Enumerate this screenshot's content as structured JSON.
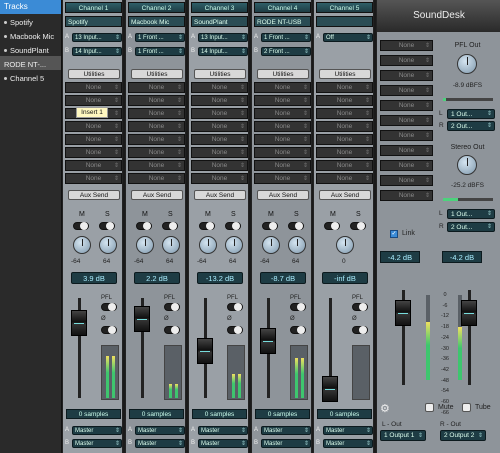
{
  "sidebar": {
    "header": "Tracks",
    "items": [
      {
        "label": "Spotify"
      },
      {
        "label": "Macbook Mic"
      },
      {
        "label": "SoundPlant"
      },
      {
        "label": "RODE NT-..."
      },
      {
        "label": "Channel 5"
      }
    ]
  },
  "channels": [
    {
      "name": "Channel 1",
      "device": "Spotify",
      "in_a": "13 Input...",
      "in_b": "14 Input...",
      "inserts": [
        "None",
        "None",
        "None",
        "None",
        "None",
        "None",
        "None",
        "None"
      ],
      "gain": "3.9 dB",
      "pan_l": "-64",
      "pan_r": "64",
      "samples": "0 samples",
      "out_a": "Master",
      "out_b": "Master"
    },
    {
      "name": "Channel 2",
      "device": "Macbook Mic",
      "in_a": "1 Front ...",
      "in_b": "1 Front ...",
      "inserts": [
        "None",
        "None",
        "None",
        "None",
        "None",
        "None",
        "None",
        "None"
      ],
      "gain": "2.2 dB",
      "pan_l": "-64",
      "pan_r": "64",
      "samples": "0 samples",
      "out_a": "Master",
      "out_b": "Master"
    },
    {
      "name": "Channel 3",
      "device": "SoundPlant",
      "in_a": "13 Input...",
      "in_b": "14 Input...",
      "inserts": [
        "None",
        "None",
        "None",
        "None",
        "None",
        "None",
        "None",
        "None"
      ],
      "gain": "-13.2 dB",
      "pan_l": "-64",
      "pan_r": "64",
      "samples": "0 samples",
      "out_a": "Master",
      "out_b": "Master"
    },
    {
      "name": "Channel 4",
      "device": "RODE NT-USB",
      "in_a": "1 Front ...",
      "in_b": "2 Front ...",
      "inserts": [
        "None",
        "None",
        "None",
        "None",
        "None",
        "None",
        "None",
        "None"
      ],
      "gain": "-8.7 dB",
      "pan_l": "-64",
      "pan_r": "64",
      "samples": "0 samples",
      "out_a": "Master",
      "out_b": "Master"
    },
    {
      "name": "Channel 5",
      "device": "",
      "in_a": "Off",
      "in_b": "",
      "inserts": [
        "None",
        "None",
        "None",
        "None",
        "None",
        "None",
        "None",
        "None"
      ],
      "gain": "-inf dB",
      "pan_l": "",
      "pan_r": "",
      "pan_c": "0",
      "samples": "0 samples",
      "out_a": "Master",
      "out_b": "Master"
    }
  ],
  "labels": {
    "utilities": "Utilities",
    "aux_send": "Aux Send",
    "mute": "M",
    "solo": "S",
    "pfl": "PFL",
    "phase": "Ø",
    "a": "A",
    "b": "B",
    "tooltip": "Insert 1"
  },
  "master": {
    "title": "SoundDesk",
    "inserts": [
      "None",
      "None",
      "None",
      "None",
      "None",
      "None",
      "None",
      "None",
      "None",
      "None",
      "None"
    ],
    "pfl_out_label": "PFL Out",
    "pfl_level": "-8.9 dBFS",
    "pfl_l": "1 Out...",
    "pfl_r": "2 Out...",
    "stereo_out_label": "Stereo Out",
    "stereo_level": "-25.2 dBFS",
    "stereo_l": "1 Out...",
    "stereo_r": "2 Out...",
    "l": "L",
    "r": "R",
    "link_label": "Link",
    "link_check": "✓",
    "gain_l": "-4.2 dB",
    "gain_r": "-4.2 dB",
    "scale": [
      "0",
      "-6",
      "-12",
      "-18",
      "-24",
      "-30",
      "-36",
      "-42",
      "-48",
      "-54",
      "-60",
      "-66"
    ],
    "mute_label": "Mute",
    "tube_label": "Tube",
    "l_out_label": "L - Out",
    "r_out_label": "R - Out",
    "l_out": "1 Output 1",
    "r_out": "2 Output 2"
  },
  "colors": {
    "accent": "#3b8bd6",
    "meter_green": "#3ec66e",
    "meter_yellow": "#f0e060"
  }
}
